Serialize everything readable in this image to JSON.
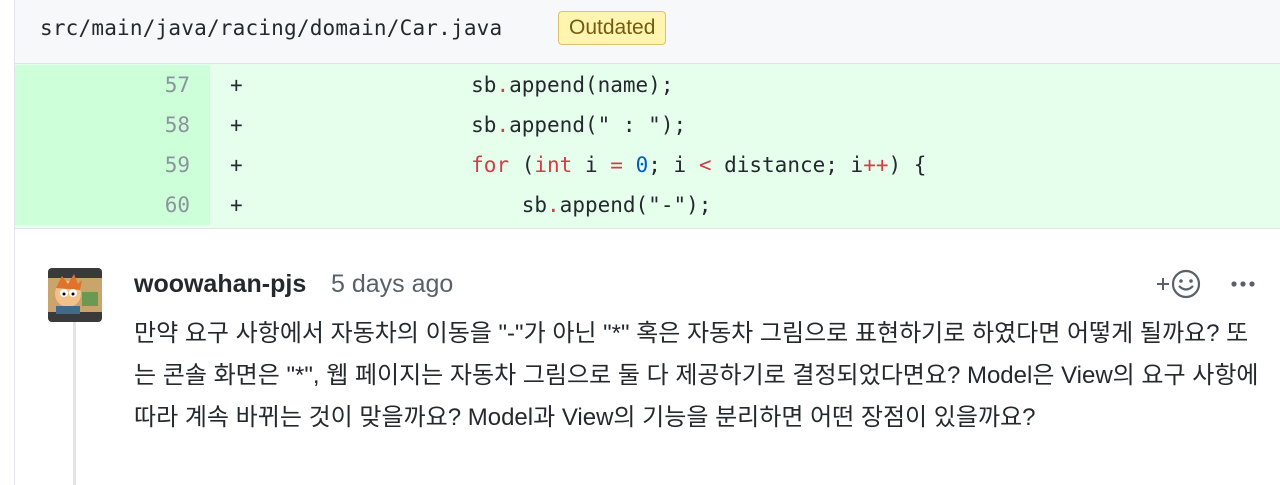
{
  "file": {
    "path": "src/main/java/racing/domain/Car.java",
    "badge": "Outdated"
  },
  "diff": [
    {
      "num": "57",
      "marker": "+",
      "indent": "        ",
      "tokens": [
        {
          "t": "sb",
          "c": ""
        },
        {
          "t": ".",
          "c": "op"
        },
        {
          "t": "append(name);",
          "c": ""
        }
      ]
    },
    {
      "num": "58",
      "marker": "+",
      "indent": "        ",
      "tokens": [
        {
          "t": "sb",
          "c": ""
        },
        {
          "t": ".",
          "c": "op"
        },
        {
          "t": "append(\" : \");",
          "c": ""
        }
      ]
    },
    {
      "num": "59",
      "marker": "+",
      "indent": "        ",
      "tokens": [
        {
          "t": "for",
          "c": "kw"
        },
        {
          "t": " (",
          "c": ""
        },
        {
          "t": "int",
          "c": "kw"
        },
        {
          "t": " i ",
          "c": ""
        },
        {
          "t": "=",
          "c": "op"
        },
        {
          "t": " ",
          "c": ""
        },
        {
          "t": "0",
          "c": "num-lit"
        },
        {
          "t": "; i ",
          "c": ""
        },
        {
          "t": "<",
          "c": "op"
        },
        {
          "t": " distance; i",
          "c": ""
        },
        {
          "t": "++",
          "c": "op"
        },
        {
          "t": ") {",
          "c": ""
        }
      ]
    },
    {
      "num": "60",
      "marker": "+",
      "indent": "            ",
      "tokens": [
        {
          "t": "sb",
          "c": ""
        },
        {
          "t": ".",
          "c": "op"
        },
        {
          "t": "append(\"-\");",
          "c": ""
        }
      ]
    }
  ],
  "comment": {
    "author": "woowahan-pjs",
    "time": "5 days ago",
    "avatar_icon": "meme-avatar-icon",
    "reaction_icon": "add-reaction-smiley-icon",
    "more_icon": "kebab-menu-icon",
    "body": "만약 요구 사항에서 자동차의 이동을 \"-\"가 아닌 \"*\" 혹은 자동차 그림으로 표현하기로 하였다면 어떻게 될까요? 또는 콘솔 화면은 \"*\", 웹 페이지는 자동차 그림으로 둘 다 제공하기로 결정되었다면요? Model은 View의 요구 사항에 따라 계속 바뀌는 것이 맞을까요? Model과 View의 기능을 분리하면 어떤 장점이 있을까요?"
  },
  "colors": {
    "added_bg": "#e6ffed",
    "added_num_bg": "#cdffd8",
    "keyword": "#d73a49",
    "number": "#005cc5",
    "badge_bg": "#fff5b1"
  }
}
